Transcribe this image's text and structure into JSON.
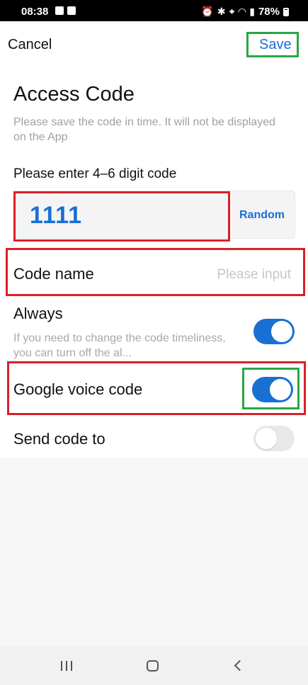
{
  "status_bar": {
    "time": "08:38",
    "battery": "78%"
  },
  "header": {
    "cancel_label": "Cancel",
    "save_label": "Save"
  },
  "page": {
    "title": "Access Code",
    "subtitle": "Please save the code in time. It will not be displayed on the App"
  },
  "code": {
    "label": "Please enter 4–6 digit code",
    "value": "1111",
    "random_label": "Random"
  },
  "code_name": {
    "label": "Code name",
    "placeholder": "Please input"
  },
  "always": {
    "label": "Always",
    "description": "If you need to change the code timeliness, you can turn off the al...",
    "enabled": true
  },
  "google_voice": {
    "label": "Google voice code",
    "enabled": true
  },
  "send_code": {
    "label": "Send code to",
    "enabled": false
  },
  "colors": {
    "accent": "#1a6fd3",
    "highlight_red": "#d8202a",
    "highlight_green": "#27a744",
    "toggle_off": "#e8e8e8"
  },
  "icons": [
    "image-icon",
    "notification-icon",
    "alarm-icon",
    "bluetooth-icon",
    "location-icon",
    "wifi-icon",
    "signal-icon",
    "battery-icon",
    "recents-icon",
    "home-icon",
    "back-icon"
  ]
}
